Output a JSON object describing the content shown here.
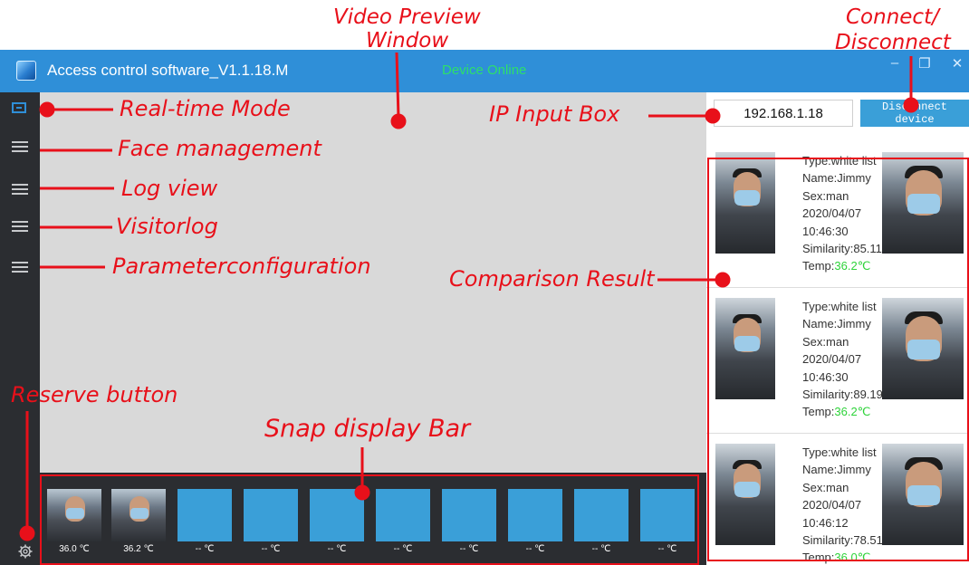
{
  "window": {
    "title": "Access control software_V1.1.18.M",
    "status": "Device Online",
    "status_color": "#2de06a",
    "accent_color": "#2f8fd8",
    "controls": [
      "–",
      "❐",
      "✕"
    ]
  },
  "sidebar": {
    "items": [
      {
        "icon": "realtime-mode-icon"
      },
      {
        "icon": "menu-list-icon"
      },
      {
        "icon": "menu-list-icon"
      },
      {
        "icon": "menu-list-icon"
      },
      {
        "icon": "menu-list-icon"
      }
    ],
    "bottom_icon": "gear-icon"
  },
  "connection": {
    "ip_value": "192.168.1.18",
    "button_label": "Disconnect device"
  },
  "results": [
    {
      "type": "Type:white list",
      "name": "Name:Jimmy",
      "sex": "Sex:man",
      "date": "2020/04/07",
      "time": "10:46:30",
      "similarity": "Similarity:85.11",
      "temp_label": "Temp:",
      "temp_value": "36.2℃"
    },
    {
      "type": "Type:white list",
      "name": "Name:Jimmy",
      "sex": "Sex:man",
      "date": "2020/04/07",
      "time": "10:46:30",
      "similarity": "Similarity:89.19",
      "temp_label": "Temp:",
      "temp_value": "36.2℃"
    },
    {
      "type": "Type:white list",
      "name": "Name:Jimmy",
      "sex": "Sex:man",
      "date": "2020/04/07",
      "time": "10:46:12",
      "similarity": "Similarity:78.51",
      "temp_label": "Temp:",
      "temp_value": "36.0℃"
    }
  ],
  "snaps": [
    {
      "temp": "36.0 ℃",
      "has_photo": true
    },
    {
      "temp": "36.2 ℃",
      "has_photo": true
    },
    {
      "temp": "-- ℃",
      "has_photo": false
    },
    {
      "temp": "-- ℃",
      "has_photo": false
    },
    {
      "temp": "-- ℃",
      "has_photo": false
    },
    {
      "temp": "-- ℃",
      "has_photo": false
    },
    {
      "temp": "-- ℃",
      "has_photo": false
    },
    {
      "temp": "-- ℃",
      "has_photo": false
    },
    {
      "temp": "-- ℃",
      "has_photo": false
    },
    {
      "temp": "-- ℃",
      "has_photo": false
    }
  ],
  "annotations": {
    "video_preview_1": "Video Preview",
    "video_preview_2": "Window",
    "connect_1": "Connect/",
    "connect_2": "Disconnect",
    "realtime": "Real-time Mode",
    "face_mgmt": "Face management",
    "log_view": "Log view",
    "visitor_log": "Visitorlog",
    "param_config": "Parameterconfiguration",
    "ip_input": "IP Input Box",
    "comparison": "Comparison Result",
    "reserve": "Reserve button",
    "snap_bar": "Snap display Bar",
    "color": "#e8101a"
  }
}
